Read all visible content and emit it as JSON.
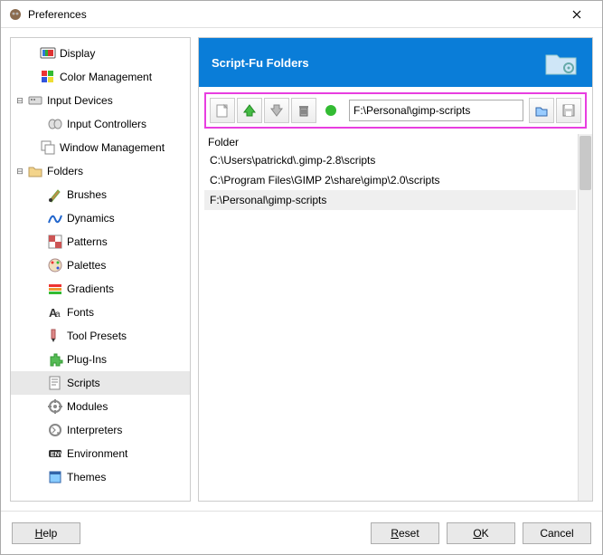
{
  "window": {
    "title": "Preferences"
  },
  "tree": {
    "display": "Display",
    "color_mgmt": "Color Management",
    "input_devices": "Input Devices",
    "input_controllers": "Input Controllers",
    "window_mgmt": "Window Management",
    "folders": "Folders",
    "brushes": "Brushes",
    "dynamics": "Dynamics",
    "patterns": "Patterns",
    "palettes": "Palettes",
    "gradients": "Gradients",
    "fonts": "Fonts",
    "tool_presets": "Tool Presets",
    "plugins": "Plug-Ins",
    "scripts": "Scripts",
    "modules": "Modules",
    "interpreters": "Interpreters",
    "environment": "Environment",
    "themes": "Themes"
  },
  "header": {
    "title": "Script-Fu Folders"
  },
  "toolbar": {
    "path_value": "F:\\Personal\\gimp-scripts"
  },
  "list": {
    "col": "Folder",
    "rows": [
      "C:\\Users\\patrickd\\.gimp-2.8\\scripts",
      "C:\\Program Files\\GIMP 2\\share\\gimp\\2.0\\scripts",
      "F:\\Personal\\gimp-scripts"
    ]
  },
  "footer": {
    "help": "Help",
    "reset": "Reset",
    "ok": "OK",
    "cancel": "Cancel"
  }
}
